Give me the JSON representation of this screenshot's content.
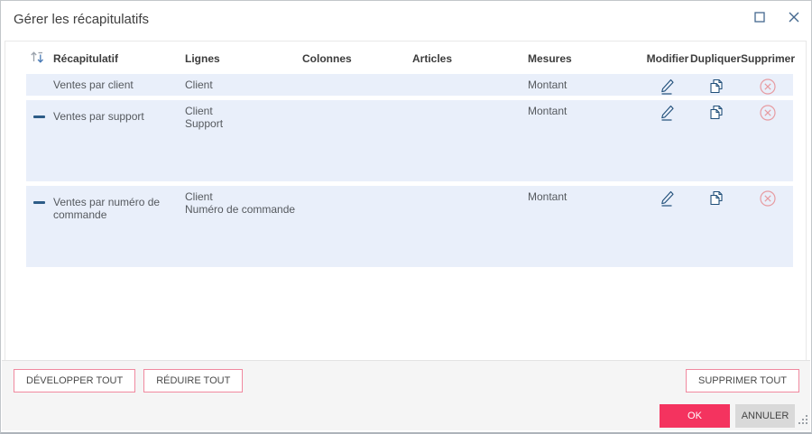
{
  "dialog": {
    "title": "Gérer les récapitulatifs"
  },
  "window_controls": {
    "maximize_icon": "square-outline",
    "close_icon": "x-mark"
  },
  "table": {
    "headers": {
      "recapitulatif": "Récapitulatif",
      "lignes": "Lignes",
      "colonnes": "Colonnes",
      "articles": "Articles",
      "mesures": "Mesures",
      "modifier": "Modifier",
      "dupliquer": "Dupliquer",
      "supprimer": "Supprimer"
    },
    "sort_icon": "sort-arrows-up-down",
    "rows": [
      {
        "name": "Ventes par client",
        "lignes": [
          "Client"
        ],
        "colonnes": [],
        "articles": [],
        "mesures": [
          "Montant"
        ],
        "expanded": false
      },
      {
        "name": "Ventes par support",
        "lignes": [
          "Client",
          "Support"
        ],
        "colonnes": [],
        "articles": [],
        "mesures": [
          "Montant"
        ],
        "expanded": true
      },
      {
        "name": "Ventes par numéro de commande",
        "lignes": [
          "Client",
          "Numéro de commande"
        ],
        "colonnes": [],
        "articles": [],
        "mesures": [
          "Montant"
        ],
        "expanded": true
      }
    ],
    "row_icons": {
      "edit": "pencil-underline",
      "duplicate": "copy-pages",
      "delete": "circle-x",
      "collapse": "minus-dash"
    }
  },
  "footer": {
    "expand_all": "DÉVELOPPER TOUT",
    "collapse_all": "RÉDUIRE TOUT",
    "delete_all": "SUPPRIMER TOUT",
    "ok": "OK",
    "cancel": "ANNULER"
  },
  "colors": {
    "accent": "#f4335f",
    "accent_border": "#f0899f",
    "row_background": "#e9effa",
    "icon_blue": "#1f4e79",
    "window_icon_blue": "#44688f",
    "delete_icon_rose": "#e79ba1",
    "footer_background": "#f5f5f5",
    "cancel_background": "#d9d9d9",
    "collapse_dash": "#2d5c87"
  }
}
